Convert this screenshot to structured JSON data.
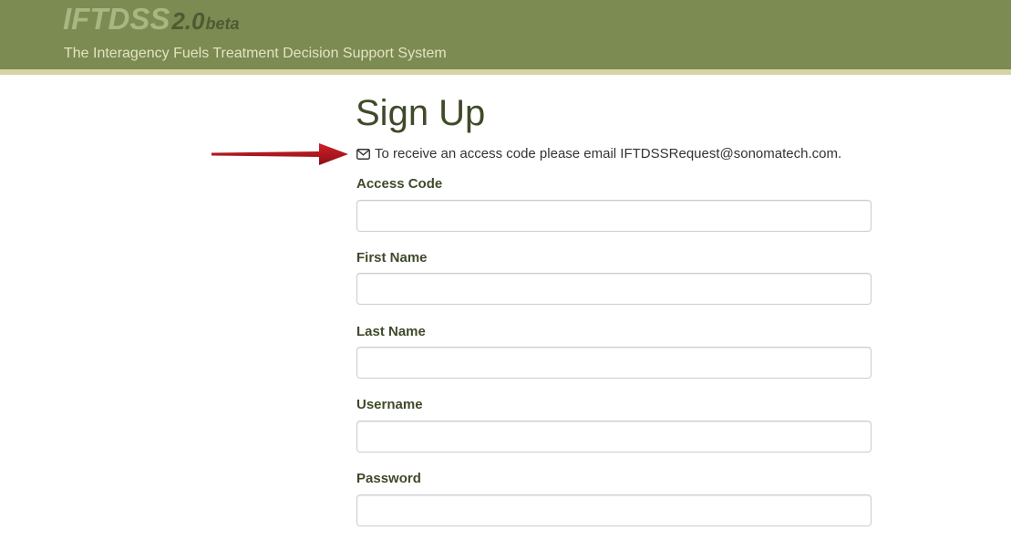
{
  "header": {
    "logo_main": "IFTDSS",
    "logo_version": "2.0",
    "logo_beta": "beta",
    "subtitle": "The Interagency Fuels Treatment Decision Support System"
  },
  "page": {
    "title": "Sign Up",
    "notice_text": "To receive an access code please email IFTDSSRequest@sonomatech.com.",
    "notice_icon": "envelope-icon"
  },
  "form": {
    "fields": [
      {
        "label": "Access Code",
        "value": "",
        "placeholder": ""
      },
      {
        "label": "First Name",
        "value": "",
        "placeholder": ""
      },
      {
        "label": "Last Name",
        "value": "",
        "placeholder": ""
      },
      {
        "label": "Username",
        "value": "",
        "placeholder": ""
      },
      {
        "label": "Password",
        "value": "",
        "placeholder": ""
      }
    ]
  },
  "colors": {
    "header_bg": "#7b8b52",
    "header_stripe": "#d6d3a6",
    "title_text": "#3f4a29",
    "annotation_arrow": "#b0141c"
  }
}
